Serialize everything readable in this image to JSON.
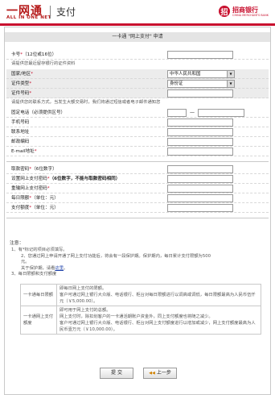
{
  "header": {
    "logo_main": "一网通",
    "logo_sub": "ALL IN ONE NET",
    "logo_title": "支付",
    "bank_icon": "招",
    "bank_name": "招商银行",
    "bank_en": "CHINA MERCHANTS BANK",
    "brand_color": "#c8102e"
  },
  "panel_title": "一卡通 \"网上支付\" 申请",
  "card_section": {
    "card_label": "卡号",
    "card_hint": "（12位或16位）",
    "id_note": "请提供您最近留存银行的证件资料",
    "region_label": "国家/地区",
    "region_value": "中华人民共和国",
    "id_type_label": "证件类型",
    "id_type_value": "身份证",
    "id_no_label": "证件号码",
    "contact_note": "请提供您的联系方式，当发生大额交易时，我们将通过短信或者电子邮件通知您",
    "phone_label": "固定电话（必须提供区号）",
    "phone_dash": "—",
    "mobile_label": "手机号码",
    "address_label": "联系地址",
    "zip_label": "邮政编码",
    "email_label": "E-mail地址"
  },
  "password_section": {
    "fetch_pwd_label": "取款密码",
    "fetch_pwd_hint": "（6位数字）",
    "set_pay_pwd_label": "设置网上支付密码",
    "set_pay_pwd_hint": "（6位数字，不能与取款密码相同）",
    "confirm_pay_pwd_label": "重输网上支付密码",
    "daily_limit_label": "每日限额",
    "daily_limit_hint": "（单位：元）",
    "pay_limit_label": "支付额度",
    "pay_limit_hint": "（单位：元）"
  },
  "notes": {
    "head": "注意：",
    "n1": "1、有*标记的项目必须填写。",
    "n2a": "2、您通过网上申请开通了网上支付功能后，将会有一段保护期。保护期内，每日累计支付限额为500",
    "n2b": "元。",
    "n2c_prefix": "关于保护期，请看",
    "n2c_link": "这里",
    "n2c_suffix": "。",
    "n3": "3、每日限额和支付额度",
    "daily_key": "一卡通每日限额",
    "daily_l1": "即每日网上支付的限额。",
    "daily_l2": "客户可通过网上银行大众版、电话银行、柜台对每日限额进行以调高或调低，每日限额最高为人民币伍仟元（￥5,000.00）。",
    "pay_key": "一卡通网上支付额度",
    "pay_l1": "即可用于网上支付的总额。",
    "pay_l2": "网上支付时，除扣划客户的一卡通活期账户资金外，同上支付额度也将随之减少。",
    "pay_l3": "客户可通过网上银行大众版、电话银行、柜台对网上支付额度进行以增加或减少，网上支付额度最高为人民币壹万元（￥10,000.00）。"
  },
  "buttons": {
    "submit": "提  交",
    "back": "上一步"
  }
}
